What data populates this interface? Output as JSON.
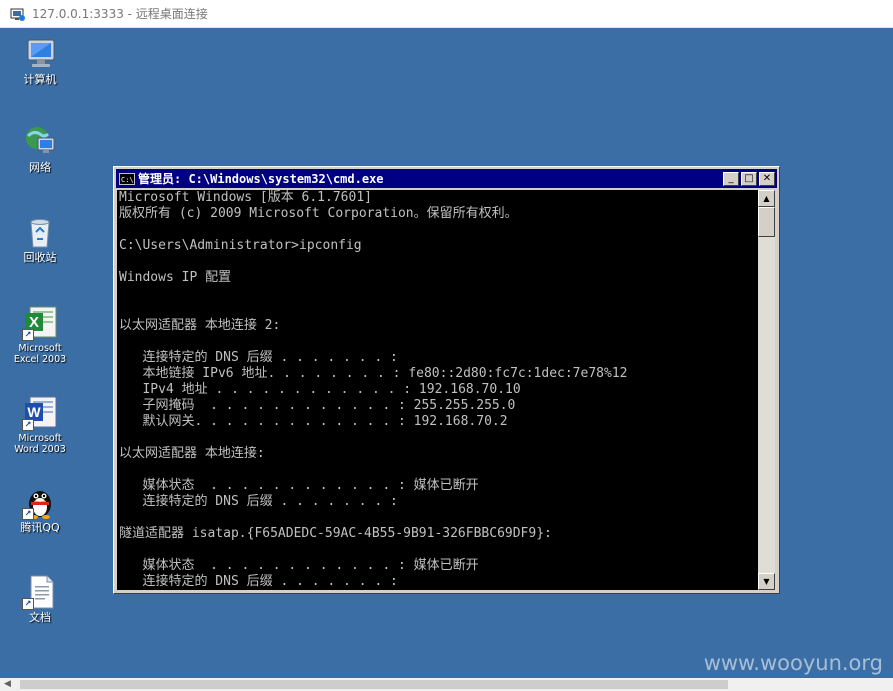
{
  "rdp": {
    "title": "127.0.0.1:3333 - 远程桌面连接"
  },
  "desktop": {
    "icons": [
      {
        "name": "computer-icon",
        "label": "计算机"
      },
      {
        "name": "network-icon",
        "label": "网络"
      },
      {
        "name": "recycle-bin-icon",
        "label": "回收站"
      },
      {
        "name": "excel-icon",
        "label": "Microsoft\nExcel 2003"
      },
      {
        "name": "word-icon",
        "label": "Microsoft\nWord 2003"
      },
      {
        "name": "qq-penguin-icon",
        "label": "腾讯QQ"
      },
      {
        "name": "document-icon",
        "label": "文档"
      }
    ],
    "background_color": "#3a6ea5"
  },
  "cmd": {
    "title": "管理员: C:\\Windows\\system32\\cmd.exe",
    "icon_text": "C:\\",
    "buttons": {
      "minimize": "_",
      "maximize": "□",
      "close": "✕"
    },
    "lines": [
      "Microsoft Windows [版本 6.1.7601]",
      "版权所有 (c) 2009 Microsoft Corporation。保留所有权利。",
      "",
      "C:\\Users\\Administrator>ipconfig",
      "",
      "Windows IP 配置",
      "",
      "",
      "以太网适配器 本地连接 2:",
      "",
      "   连接特定的 DNS 后缀 . . . . . . . :",
      "   本地链接 IPv6 地址. . . . . . . . : fe80::2d80:fc7c:1dec:7e78%12",
      "   IPv4 地址 . . . . . . . . . . . . : 192.168.70.10",
      "   子网掩码  . . . . . . . . . . . . : 255.255.255.0",
      "   默认网关. . . . . . . . . . . . . : 192.168.70.2",
      "",
      "以太网适配器 本地连接:",
      "",
      "   媒体状态  . . . . . . . . . . . . : 媒体已断开",
      "   连接特定的 DNS 后缀 . . . . . . . :",
      "",
      "隧道适配器 isatap.{F65ADEDC-59AC-4B55-9B91-326FBBC69DF9}:",
      "",
      "   媒体状态  . . . . . . . . . . . . : 媒体已断开",
      "   连接特定的 DNS 后缀 . . . . . . . :"
    ]
  },
  "watermark": "www.wooyun.org"
}
